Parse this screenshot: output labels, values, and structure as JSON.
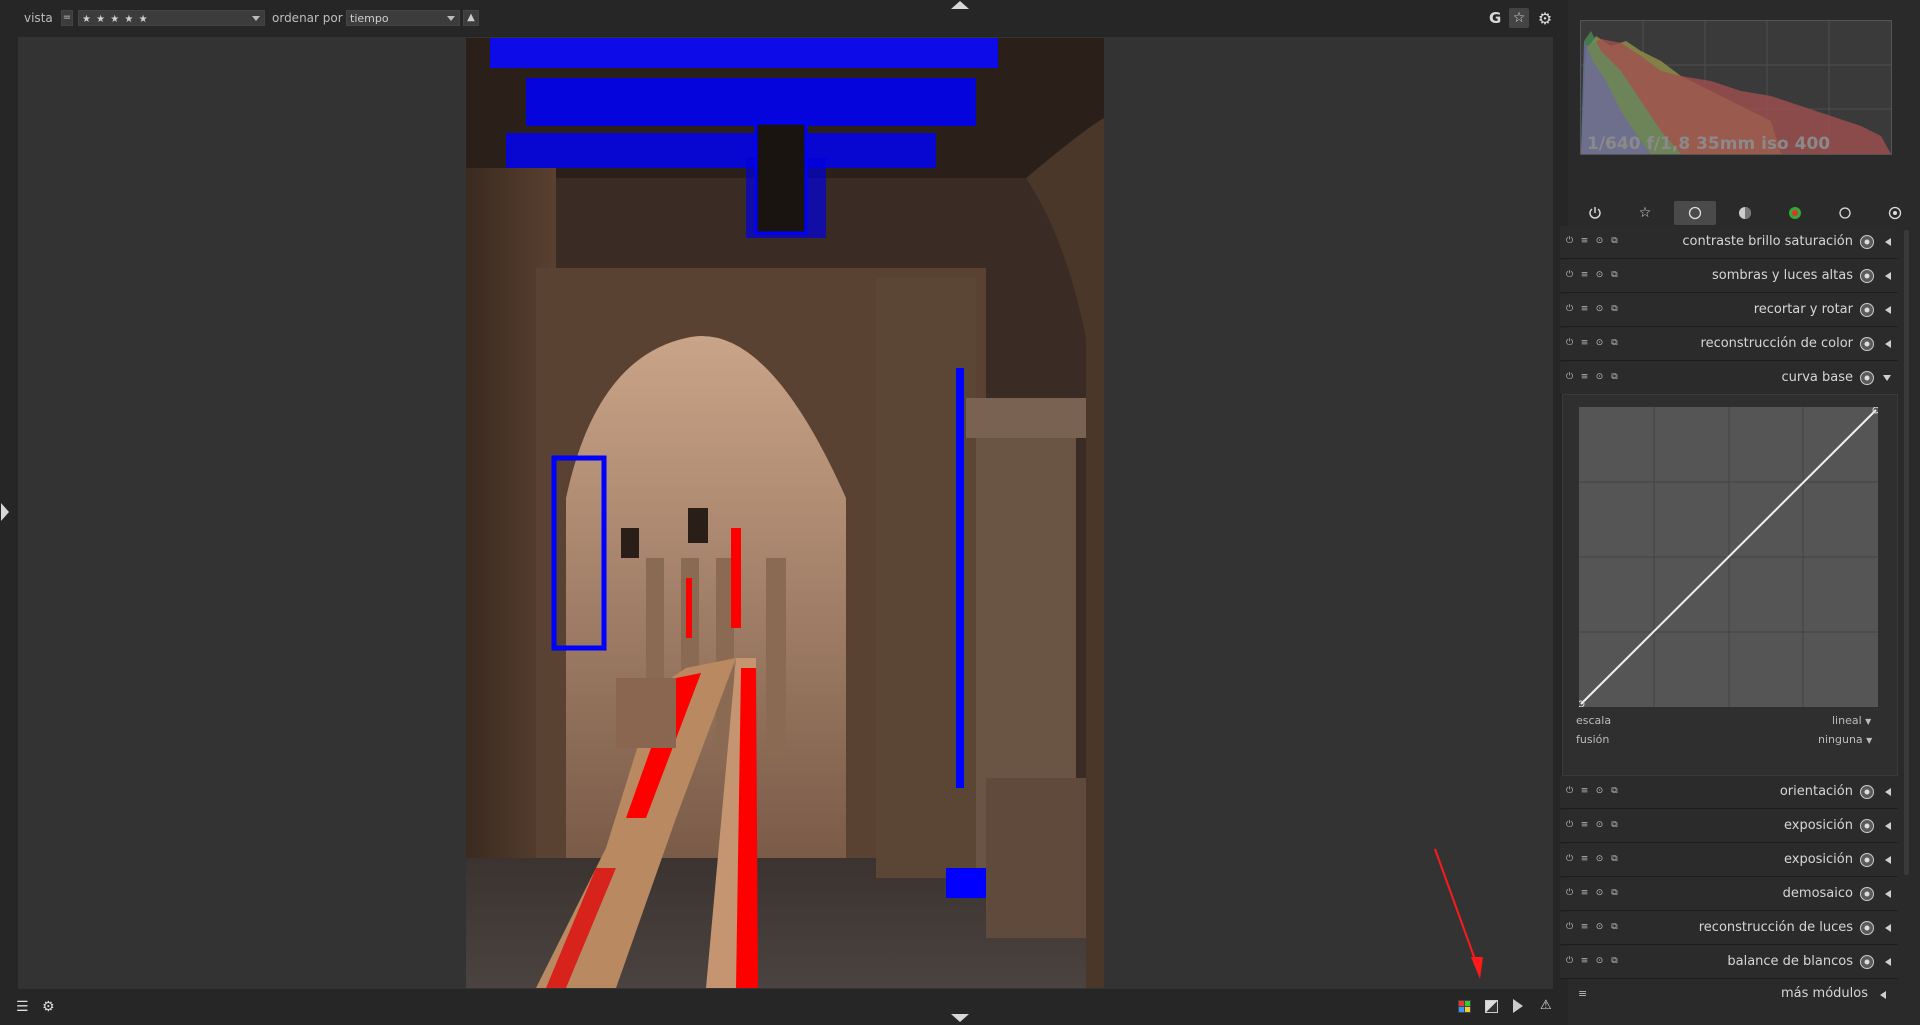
{
  "topbar": {
    "view_label": "vista",
    "view_operator": "=",
    "view_value": "★ ★ ★ ★ ★",
    "sort_label": "ordenar por",
    "sort_value": "tiempo",
    "sort_dir": "▲",
    "right_icons": [
      "G",
      "star-icon",
      "gear-icon"
    ]
  },
  "histogram": {
    "exif": "1/640 f/1,8 35mm iso 400"
  },
  "module_groups": [
    "power-icon",
    "favourites-icon",
    "base-icon",
    "tone-icon",
    "color-icon",
    "correct-icon",
    "effect-icon"
  ],
  "modules": [
    {
      "name": "contraste brillo saturación",
      "icon": "color-wheel-icon",
      "expanded": false
    },
    {
      "name": "sombras y luces altas",
      "icon": "sphere-icon",
      "expanded": false
    },
    {
      "name": "recortar y rotar",
      "icon": "crop-icon",
      "expanded": false
    },
    {
      "name": "reconstrucción de color",
      "icon": "color-reconstruct-icon",
      "expanded": false
    },
    {
      "name": "curva base",
      "icon": "curve-icon",
      "expanded": true
    },
    {
      "name": "orientación",
      "icon": "orientation-icon",
      "expanded": false
    },
    {
      "name": "exposición",
      "icon": "exposure-icon",
      "expanded": false
    },
    {
      "name": "exposición",
      "icon": "exposure-icon",
      "expanded": false
    },
    {
      "name": "demosaico",
      "icon": "demosaic-icon",
      "expanded": false
    },
    {
      "name": "reconstrucción de luces",
      "icon": "highlight-icon",
      "expanded": false
    },
    {
      "name": "balance de blancos",
      "icon": "white-balance-icon",
      "expanded": false
    }
  ],
  "more_modules": "más módulos",
  "curve": {
    "scale_label": "escala",
    "scale_value": "lineal",
    "blend_label": "fusión",
    "blend_value": "ninguna"
  },
  "colors": {
    "clipping_over": "#ff0000",
    "clipping_under": "#0000ff",
    "background": "#262626",
    "center": "#333333"
  }
}
